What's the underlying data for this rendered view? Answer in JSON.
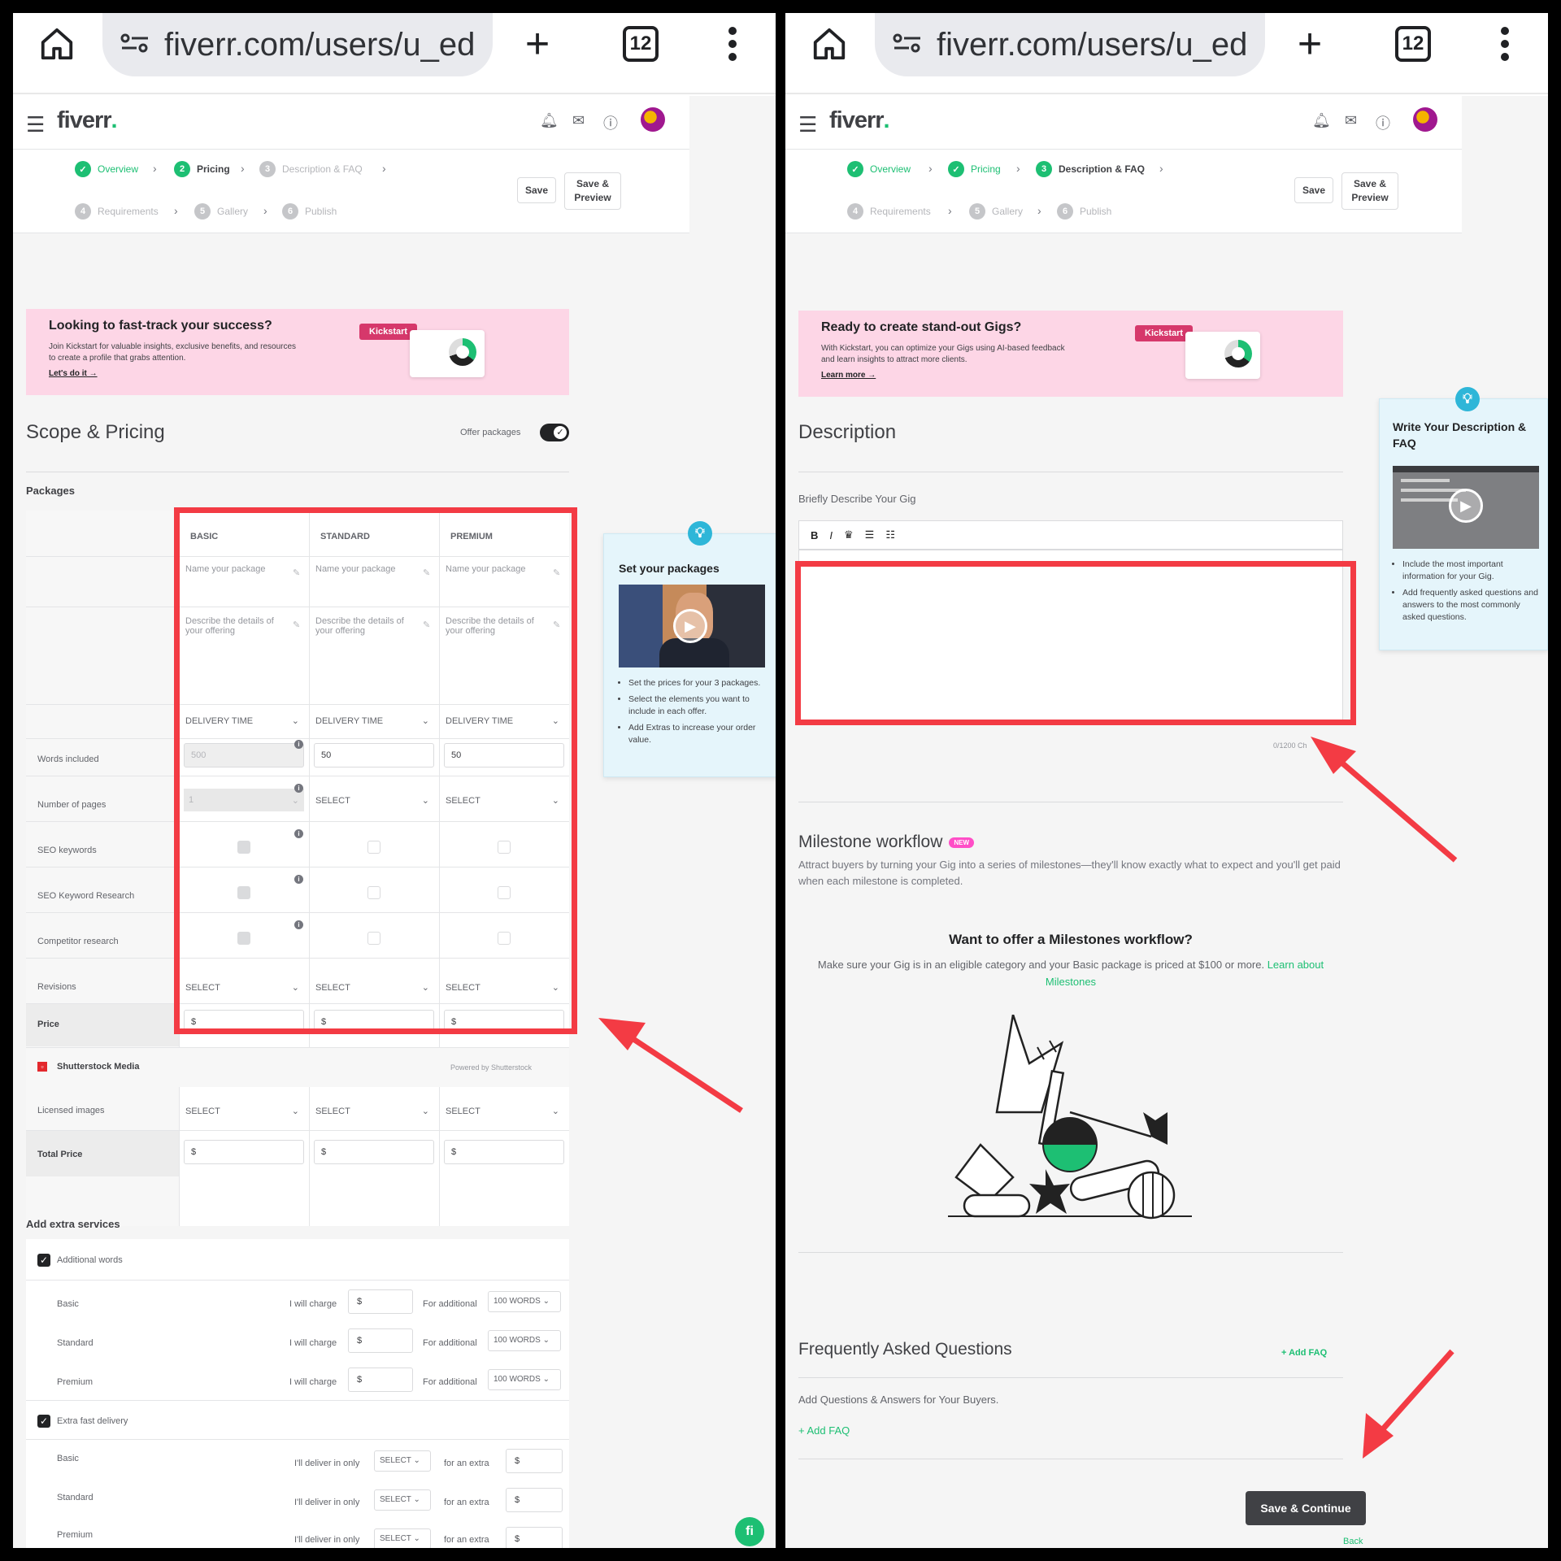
{
  "browser": {
    "url": "fiverr.com/users/u_ed",
    "tab_count": "12"
  },
  "site": {
    "logo": "fiverr",
    "logo_dot": "."
  },
  "left": {
    "steps": [
      {
        "num": "✓",
        "label": "Overview",
        "state": "done"
      },
      {
        "num": "2",
        "label": "Pricing",
        "state": "current"
      },
      {
        "num": "3",
        "label": "Description & FAQ",
        "state": "todo"
      },
      {
        "num": "4",
        "label": "Requirements",
        "state": "todo"
      },
      {
        "num": "5",
        "label": "Gallery",
        "state": "todo"
      },
      {
        "num": "6",
        "label": "Publish",
        "state": "todo"
      }
    ],
    "save_label": "Save",
    "save_preview_label": "Save & Preview",
    "banner": {
      "title": "Looking to fast-track your success?",
      "text": "Join Kickstart for valuable insights, exclusive benefits, and resources to create a profile that grabs attention.",
      "link": "Let's do it →",
      "badge": "Kickstart"
    },
    "section_title": "Scope & Pricing",
    "offer_packages": "Offer packages",
    "packages_label": "Packages",
    "columns": [
      "BASIC",
      "STANDARD",
      "PREMIUM"
    ],
    "name_placeholder": "Name your package",
    "describe_placeholder": "Describe the details of your offering",
    "delivery_time": "DELIVERY TIME",
    "rows": {
      "words_included": "Words included",
      "number_of_pages": "Number of pages",
      "seo_keywords": "SEO keywords",
      "seo_keyword_research": "SEO Keyword Research",
      "competitor_research": "Competitor research",
      "revisions": "Revisions",
      "price": "Price"
    },
    "words_values": [
      "500",
      "50",
      "50"
    ],
    "pages_values": [
      "1",
      "SELECT",
      "SELECT"
    ],
    "select": "SELECT",
    "dollar": "$",
    "shutterstock": "Shutterstock Media",
    "powered": "Powered by Shutterstock",
    "licensed_images": "Licensed images",
    "total_price": "Total Price",
    "extras_title": "Add extra services",
    "additional_words": "Additional words",
    "extra_fast": "Extra fast delivery",
    "tiers": [
      "Basic",
      "Standard",
      "Premium"
    ],
    "i_will_charge": "I will charge",
    "for_additional": "For additional",
    "hundred_words": "100 WORDS",
    "ill_deliver": "I'll deliver in only",
    "for_an_extra": "for an extra",
    "tip": {
      "title": "Set your packages",
      "items": [
        "Set the prices for your 3 packages.",
        "Select the elements you want to include in each offer.",
        "Add Extras to increase your order value."
      ]
    },
    "fab": "fi"
  },
  "right": {
    "steps": [
      {
        "num": "✓",
        "label": "Overview",
        "state": "done"
      },
      {
        "num": "✓",
        "label": "Pricing",
        "state": "done"
      },
      {
        "num": "3",
        "label": "Description & FAQ",
        "state": "current"
      },
      {
        "num": "4",
        "label": "Requirements",
        "state": "todo"
      },
      {
        "num": "5",
        "label": "Gallery",
        "state": "todo"
      },
      {
        "num": "6",
        "label": "Publish",
        "state": "todo"
      }
    ],
    "banner": {
      "title": "Ready to create stand-out Gigs?",
      "text": "With Kickstart, you can optimize your Gigs using AI-based feedback and learn insights to attract more clients.",
      "link": "Learn more →",
      "badge": "Kickstart"
    },
    "section_title": "Description",
    "briefly": "Briefly Describe Your Gig",
    "toolbar": [
      "B",
      "I",
      "♛",
      "☰",
      "☷"
    ],
    "char_count": "0/1200 Ch",
    "milestone_title": "Milestone workflow",
    "new_badge": "NEW",
    "milestone_text": "Attract buyers by turning your Gig into a series of milestones—they'll know exactly what to expect and you'll get paid when each milestone is completed.",
    "want_title": "Want to offer a Milestones workflow?",
    "want_text": "Make sure your Gig is in an eligible category and your Basic package is priced at $100 or more.",
    "learn_link": "Learn about Milestones",
    "faq_title": "Frequently Asked Questions",
    "add_faq_top": "+ Add FAQ",
    "faq_text": "Add Questions & Answers for Your Buyers.",
    "add_faq": "+ Add FAQ",
    "save_continue": "Save & Continue",
    "back": "Back",
    "tip": {
      "title": "Write Your Description & FAQ",
      "items": [
        "Include the most important information for your Gig.",
        "Add frequently asked questions and answers to the most commonly asked questions."
      ]
    }
  },
  "colors": {
    "accent": "#1dbf73",
    "highlight": "#f33b44",
    "banner": "#fdd6e6"
  }
}
